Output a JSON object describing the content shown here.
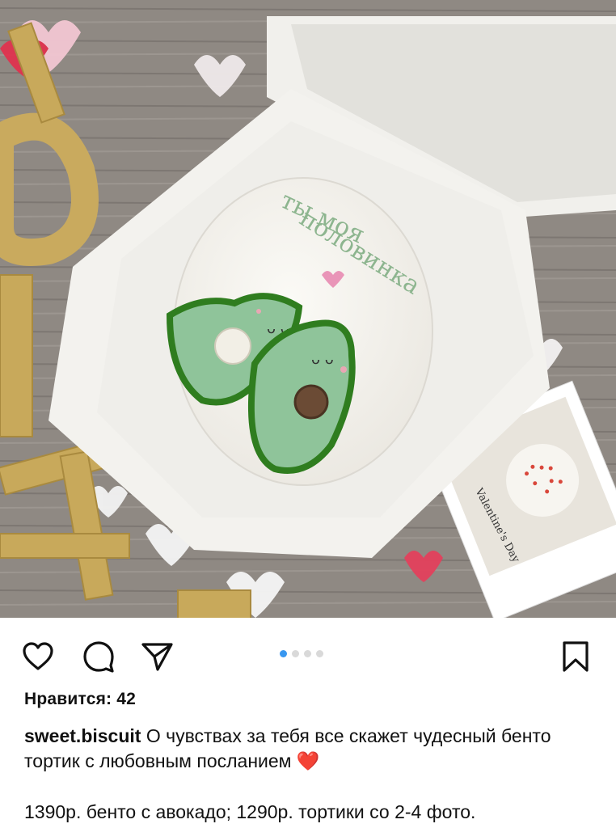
{
  "post": {
    "photo": {
      "cake_text_line1": "ты моя",
      "cake_text_line2": "половинка",
      "postcard_text": "Valentine's Day"
    },
    "actions": {
      "like_icon": "heart-icon",
      "comment_icon": "comment-icon",
      "share_icon": "send-icon",
      "save_icon": "bookmark-icon"
    },
    "carousel": {
      "total": 4,
      "active": 1
    },
    "likes": "Нравится: 42",
    "username": "sweet.biscuit",
    "caption": "О чувствах за тебя все скажет чудесный бенто тортик с любовным посланием",
    "caption_emoji": "❤️",
    "price_line": "1390р. бенто с авокадо; 1290р. тортики со 2-4 фото.",
    "colors": {
      "accent_dot": "#3897f0",
      "table": "#8b8580",
      "avocado": "#8fc49a",
      "avocado_edge": "#2f7d1f"
    }
  }
}
